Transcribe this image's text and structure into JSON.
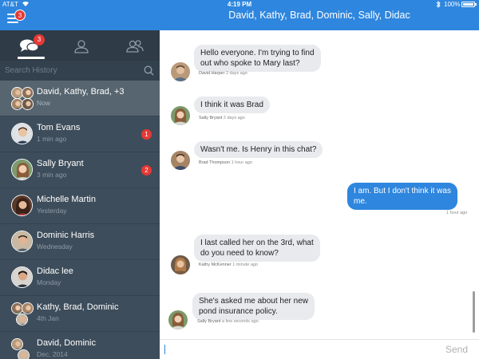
{
  "status_bar": {
    "carrier": "AT&T",
    "time": "4:19 PM",
    "battery": "100%"
  },
  "header": {
    "title": "David, Kathy, Brad, Dominic, Sally, Didac",
    "menu_badge": "3"
  },
  "sidebar": {
    "tabs": [
      {
        "icon": "chat-bubbles-icon",
        "badge": "3",
        "active": true
      },
      {
        "icon": "person-icon",
        "active": false
      },
      {
        "icon": "people-icon",
        "active": false
      }
    ],
    "search_placeholder": "Search History",
    "conversations": [
      {
        "name": "David, Kathy, Brad, +3",
        "sub": "Now",
        "group": true,
        "selected": true
      },
      {
        "name": "Tom Evans",
        "sub": "1 min ago",
        "unread": "1"
      },
      {
        "name": "Sally Bryant",
        "sub": "3 min ago",
        "unread": "2"
      },
      {
        "name": "Michelle Martin",
        "sub": "Yesterday"
      },
      {
        "name": "Dominic Harris",
        "sub": "Wednesday"
      },
      {
        "name": "Didac lee",
        "sub": "Monday"
      },
      {
        "name": "Kathy, Brad, Dominic",
        "sub": "4th Jan",
        "group": true
      },
      {
        "name": "David, Dominic",
        "sub": "Dec, 2014",
        "group": true
      }
    ]
  },
  "messages": [
    {
      "lines": [
        "Hello everyone. I'm trying to find",
        "out who spoke to Mary last?"
      ],
      "sender": "David Harper",
      "time": "2 days ago",
      "outgoing": false
    },
    {
      "lines": [
        "I think it was Brad"
      ],
      "sender": "Sally Bryant",
      "time": "2 days ago",
      "outgoing": false
    },
    {
      "lines": [
        "Wasn't me. Is Henry in this chat?"
      ],
      "sender": "Brad Thompson",
      "time": "1 hour ago",
      "outgoing": false
    },
    {
      "lines": [
        "I am. But I don't think it was",
        "me."
      ],
      "sender": "",
      "time": "1 hour ago",
      "outgoing": true
    },
    {
      "lines": [
        "I last called her on the 3rd, what",
        "do you need to know?"
      ],
      "sender": "Kathy McKenner",
      "time": "1 minute ago",
      "outgoing": false
    },
    {
      "lines": [
        "She's asked me about her new",
        "pond insurance policy."
      ],
      "sender": "Sally Bryant",
      "time": "a few seconds ago",
      "outgoing": false
    }
  ],
  "composer": {
    "value": "",
    "send_label": "Send"
  },
  "colors": {
    "accent": "#2e86de",
    "sidebar": "#3e4d5b",
    "badge": "#e53935"
  }
}
